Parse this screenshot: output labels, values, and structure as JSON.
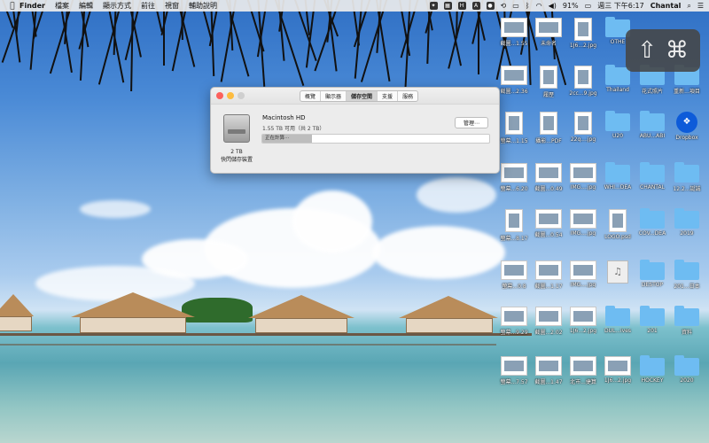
{
  "menubar": {
    "app": "Finder",
    "items": [
      "檔案",
      "編輯",
      "顯示方式",
      "前往",
      "視窗",
      "輔助說明"
    ],
    "battery": "91%",
    "clock": "週三 下午6:17",
    "user": "Chantal"
  },
  "window": {
    "tabs": [
      "概覽",
      "顯示器",
      "儲存空間",
      "支援",
      "服務"
    ],
    "active_tab": "儲存空間",
    "volume_name": "Macintosh HD",
    "volume_sub": "1.55 TB 可用（共 2 TB）",
    "manage_label": "管理⋯",
    "bar_label": "正在計算⋯",
    "bar_fraction": 0.22,
    "disk_size": "2 TB",
    "disk_type": "快閃儲存裝置"
  },
  "keyhud": {
    "shift": "⇧",
    "cmd": "⌘"
  },
  "desktop_icons": [
    {
      "label": "截圖...1.55",
      "kind": "thumb"
    },
    {
      "label": "未命名",
      "kind": "thumb"
    },
    {
      "label": "1J6...2.jpg",
      "kind": "doc"
    },
    {
      "label": "OTHE",
      "kind": "folder"
    },
    {
      "label": "截圖...2.36",
      "kind": "thumb"
    },
    {
      "label": "履歷",
      "kind": "doc"
    },
    {
      "label": "2cc...9.jpg",
      "kind": "doc"
    },
    {
      "label": "Thailand",
      "kind": "folder"
    },
    {
      "label": "花式照片",
      "kind": "folder"
    },
    {
      "label": "重新...項目",
      "kind": "folder"
    },
    {
      "label": "螢幕...1.15",
      "kind": "doc"
    },
    {
      "label": "攝影...PDF",
      "kind": "doc"
    },
    {
      "label": "22q....jpg",
      "kind": "doc"
    },
    {
      "label": "U20",
      "kind": "folder"
    },
    {
      "label": "ABU...ABI",
      "kind": "folder"
    },
    {
      "label": "Dropbox",
      "kind": "dropbox"
    },
    {
      "label": "螢幕...6.20",
      "kind": "thumb"
    },
    {
      "label": "截圖...0.49",
      "kind": "thumb"
    },
    {
      "label": "IMG....jpg",
      "kind": "thumb"
    },
    {
      "label": "WHI...DEA",
      "kind": "folder"
    },
    {
      "label": "CHANTAL",
      "kind": "folder"
    },
    {
      "label": "12.2...誕誠",
      "kind": "folder"
    },
    {
      "label": "螢幕...8.17",
      "kind": "doc"
    },
    {
      "label": "截圖...0.54",
      "kind": "thumb"
    },
    {
      "label": "IMG....jpg",
      "kind": "thumb"
    },
    {
      "label": "LOGO.psd",
      "kind": "doc"
    },
    {
      "label": "COV...DEA",
      "kind": "folder"
    },
    {
      "label": "2019",
      "kind": "folder"
    },
    {
      "label": "螢幕...0.8",
      "kind": "thumb"
    },
    {
      "label": "截圖...1.17",
      "kind": "thumb"
    },
    {
      "label": "IMG....jpg",
      "kind": "thumb"
    },
    {
      "label": "",
      "kind": "music"
    },
    {
      "label": "DESTOP",
      "kind": "folder"
    },
    {
      "label": "201...日本",
      "kind": "folder"
    },
    {
      "label": "螢幕...9.29",
      "kind": "thumb"
    },
    {
      "label": "截圖...2.02",
      "kind": "thumb"
    },
    {
      "label": "1J6...2.jpg",
      "kind": "thumb"
    },
    {
      "label": "DUL...ives",
      "kind": "folder"
    },
    {
      "label": "201",
      "kind": "folder"
    },
    {
      "label": "資料",
      "kind": "folder"
    },
    {
      "label": "螢幕...7.57",
      "kind": "thumb"
    },
    {
      "label": "截圖...1.47",
      "kind": "thumb"
    },
    {
      "label": "北市...捷算",
      "kind": "thumb"
    },
    {
      "label": "1J6...2.jpg",
      "kind": "thumb"
    },
    {
      "label": "HOCKEY",
      "kind": "folder"
    },
    {
      "label": "2020",
      "kind": "folder"
    }
  ]
}
